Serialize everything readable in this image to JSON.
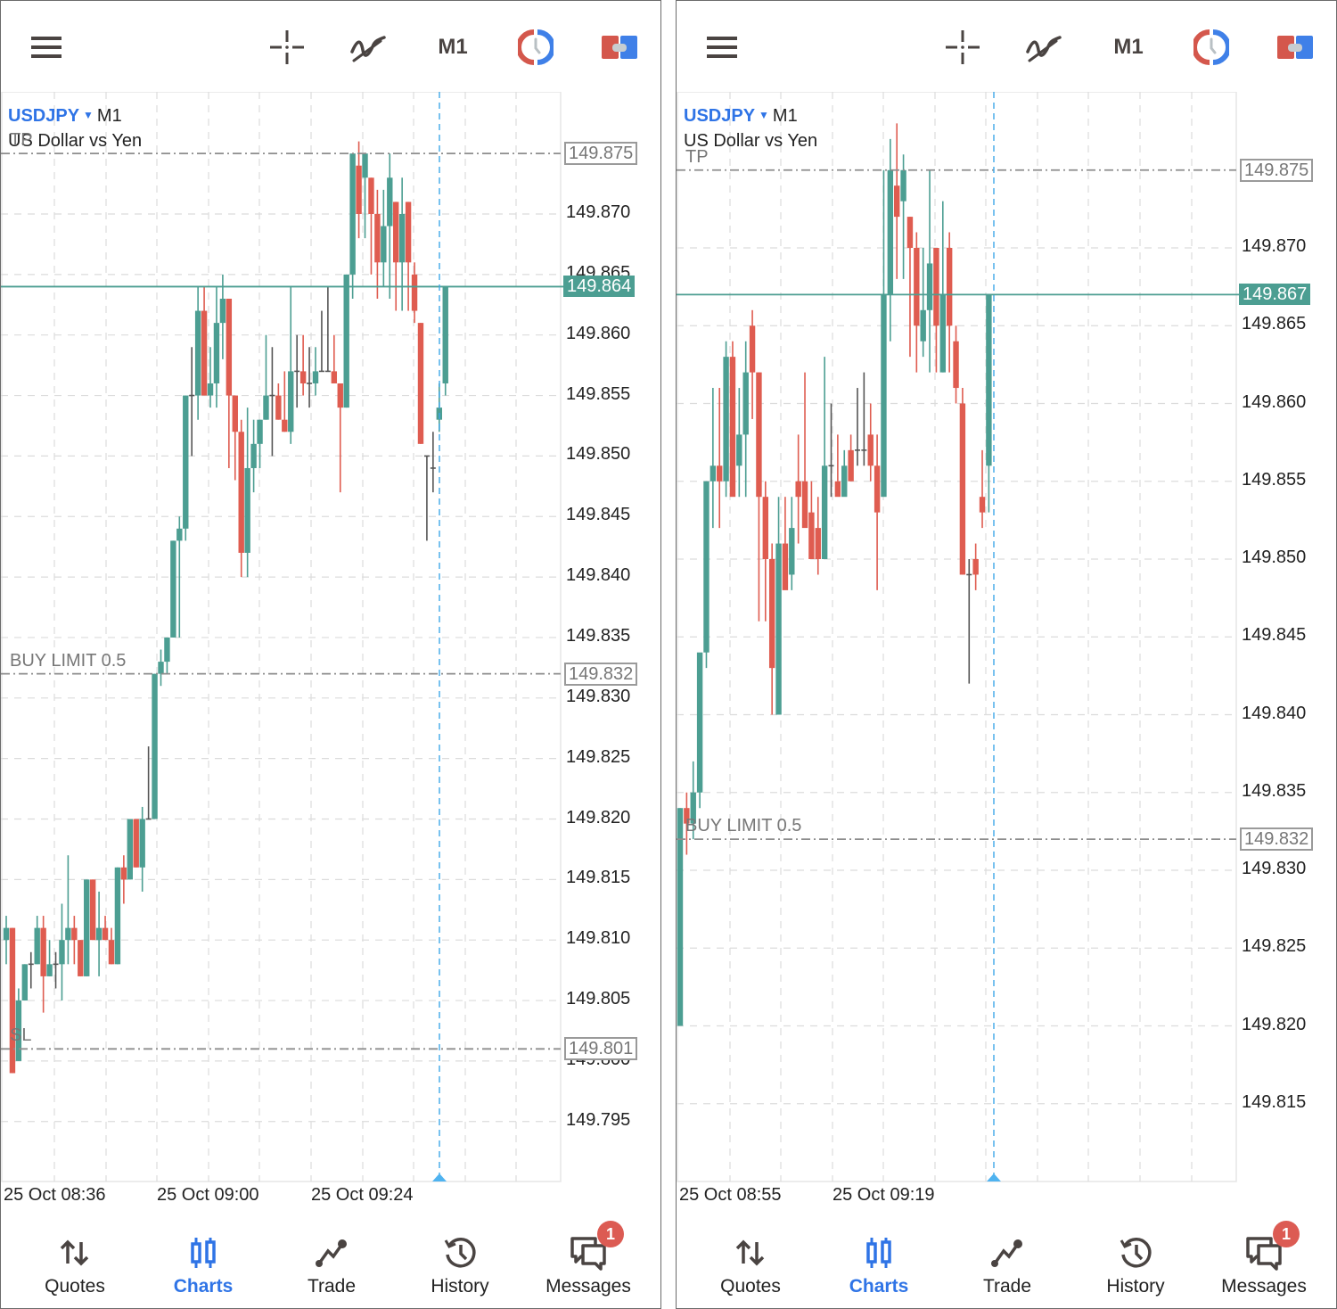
{
  "toolbar": {
    "menu_icon": "hamburger-menu-icon",
    "crosshair_icon": "crosshair-icon",
    "indicators_icon": "indicators-icon",
    "timeframe": "M1",
    "trade_clock_icon": "one-click-trading-icon",
    "toggle_icon": "trade-panel-toggle-icon",
    "colors": {
      "icon": "#4a4442",
      "red": "#d4574c",
      "blue": "#3f80e8"
    }
  },
  "bottom_nav": {
    "items": [
      {
        "label": "Quotes",
        "icon": "quotes-arrows-icon",
        "active": false
      },
      {
        "label": "Charts",
        "icon": "charts-candles-icon",
        "active": true
      },
      {
        "label": "Trade",
        "icon": "trade-line-icon",
        "active": false
      },
      {
        "label": "History",
        "icon": "history-clock-icon",
        "active": false
      },
      {
        "label": "Messages",
        "icon": "messages-icon",
        "active": false,
        "badge": "1"
      }
    ],
    "active_color": "#2f74e6"
  },
  "chart_data": [
    {
      "type": "candlestick",
      "symbol": "USDJPY",
      "timeframe": "M1",
      "description": "US Dollar vs Yen",
      "y_ticks": [
        "149.870",
        "149.865",
        "149.860",
        "149.855",
        "149.850",
        "149.845",
        "149.840",
        "149.835",
        "149.830",
        "149.825",
        "149.820",
        "149.815",
        "149.810",
        "149.805",
        "149.800",
        "149.795"
      ],
      "ylim": [
        149.7925,
        149.8755
      ],
      "x_ticks": [
        "25 Oct 08:36",
        "25 Oct 09:00",
        "25 Oct 09:24"
      ],
      "grid": true,
      "bull_color": "#4c9e92",
      "bear_color": "#df5c50",
      "doji_color": "#555555",
      "current_price": {
        "value": 149.864,
        "label": "149.864"
      },
      "levels": [
        {
          "name": "TP",
          "value": 149.875,
          "label": "149.875",
          "text": "TP"
        },
        {
          "name": "BUY LIMIT 0.5",
          "value": 149.832,
          "label": "149.832",
          "text": "BUY LIMIT 0.5"
        },
        {
          "name": "SL",
          "value": 149.801,
          "label": "149.801",
          "text": "SL"
        }
      ],
      "candles": [
        [
          149.81,
          149.812,
          149.808,
          149.811
        ],
        [
          149.811,
          149.811,
          149.799,
          149.799
        ],
        [
          149.8,
          149.806,
          149.8,
          149.805
        ],
        [
          149.805,
          149.808,
          149.805,
          149.808
        ],
        [
          149.808,
          149.809,
          149.806,
          149.808
        ],
        [
          149.808,
          149.812,
          149.808,
          149.811
        ],
        [
          149.811,
          149.812,
          149.804,
          149.807
        ],
        [
          149.807,
          149.81,
          149.807,
          149.808
        ],
        [
          149.808,
          149.809,
          149.806,
          149.808
        ],
        [
          149.808,
          149.813,
          149.805,
          149.81
        ],
        [
          149.81,
          149.817,
          149.808,
          149.811
        ],
        [
          149.811,
          149.812,
          149.808,
          149.81
        ],
        [
          149.81,
          149.81,
          149.807,
          149.807
        ],
        [
          149.807,
          149.815,
          149.807,
          149.815
        ],
        [
          149.815,
          149.815,
          149.81,
          149.81
        ],
        [
          149.81,
          149.814,
          149.807,
          149.811
        ],
        [
          149.811,
          149.812,
          149.81,
          149.81
        ],
        [
          149.81,
          149.811,
          149.808,
          149.808
        ],
        [
          149.808,
          149.816,
          149.808,
          149.816
        ],
        [
          149.816,
          149.817,
          149.813,
          149.815
        ],
        [
          149.815,
          149.82,
          149.815,
          149.82
        ],
        [
          149.82,
          149.82,
          149.816,
          149.816
        ],
        [
          149.816,
          149.821,
          149.814,
          149.82
        ],
        [
          149.82,
          149.826,
          149.82,
          149.82
        ],
        [
          149.82,
          149.832,
          149.82,
          149.832
        ],
        [
          149.832,
          149.834,
          149.831,
          149.833
        ],
        [
          149.833,
          149.835,
          149.832,
          149.835
        ],
        [
          149.835,
          149.843,
          149.835,
          149.843
        ],
        [
          149.843,
          149.845,
          149.835,
          149.844
        ],
        [
          149.844,
          149.855,
          149.843,
          149.855
        ],
        [
          149.855,
          149.859,
          149.85,
          149.855
        ],
        [
          149.855,
          149.864,
          149.853,
          149.862
        ],
        [
          149.862,
          149.864,
          149.855,
          149.855
        ],
        [
          149.855,
          149.859,
          149.854,
          149.856
        ],
        [
          149.856,
          149.864,
          149.854,
          149.861
        ],
        [
          149.861,
          149.865,
          149.858,
          149.863
        ],
        [
          149.863,
          149.863,
          149.849,
          149.855
        ],
        [
          149.855,
          149.855,
          149.848,
          149.852
        ],
        [
          149.852,
          149.853,
          149.84,
          149.842
        ],
        [
          149.842,
          149.854,
          149.84,
          149.849
        ],
        [
          149.849,
          149.853,
          149.847,
          149.851
        ],
        [
          149.851,
          149.853,
          149.849,
          149.853
        ],
        [
          149.853,
          149.86,
          149.853,
          149.855
        ],
        [
          149.855,
          149.859,
          149.85,
          149.855
        ],
        [
          149.855,
          149.856,
          149.853,
          149.853
        ],
        [
          149.853,
          149.857,
          149.852,
          149.852
        ],
        [
          149.852,
          149.864,
          149.851,
          149.857
        ],
        [
          149.857,
          149.86,
          149.854,
          149.857
        ],
        [
          149.857,
          149.86,
          149.855,
          149.856
        ],
        [
          149.856,
          149.859,
          149.854,
          149.856
        ],
        [
          149.856,
          149.859,
          149.855,
          149.857
        ],
        [
          149.857,
          149.862,
          149.857,
          149.857
        ],
        [
          149.857,
          149.864,
          149.857,
          149.857
        ],
        [
          149.857,
          149.86,
          149.856,
          149.856
        ],
        [
          149.856,
          149.856,
          149.847,
          149.854
        ],
        [
          149.854,
          149.865,
          149.854,
          149.865
        ],
        [
          149.865,
          149.874,
          149.863,
          149.875
        ],
        [
          149.874,
          149.876,
          149.868,
          149.87
        ],
        [
          149.873,
          149.874,
          149.868,
          149.875
        ],
        [
          149.873,
          149.873,
          149.865,
          149.87
        ],
        [
          149.87,
          149.872,
          149.863,
          149.866
        ],
        [
          149.866,
          149.872,
          149.864,
          149.869
        ],
        [
          149.869,
          149.875,
          149.863,
          149.873
        ],
        [
          149.871,
          149.871,
          149.862,
          149.866
        ],
        [
          149.866,
          149.873,
          149.862,
          149.87
        ],
        [
          149.871,
          149.871,
          149.862,
          149.866
        ],
        [
          149.865,
          149.866,
          149.861,
          149.862
        ],
        [
          149.861,
          149.861,
          149.851,
          149.851
        ],
        [
          149.85,
          149.85,
          149.843,
          149.85
        ],
        [
          149.849,
          149.852,
          149.847,
          149.849
        ],
        [
          149.853,
          149.856,
          149.852,
          149.854
        ],
        [
          149.856,
          149.864,
          149.855,
          149.864
        ]
      ]
    },
    {
      "type": "candlestick",
      "symbol": "USDJPY",
      "timeframe": "M1",
      "description": "US Dollar vs Yen",
      "y_ticks": [
        "149.870",
        "149.865",
        "149.860",
        "149.855",
        "149.850",
        "149.845",
        "149.840",
        "149.835",
        "149.830",
        "149.825",
        "149.820",
        "149.815"
      ],
      "ylim": [
        149.8117,
        149.8767
      ],
      "x_ticks": [
        "25 Oct 08:55",
        "25 Oct 09:19"
      ],
      "grid": true,
      "bull_color": "#4c9e92",
      "bear_color": "#df5c50",
      "doji_color": "#555555",
      "current_price": {
        "value": 149.867,
        "label": "149.867"
      },
      "levels": [
        {
          "name": "TP",
          "value": 149.875,
          "label": "149.875",
          "text": "TP"
        },
        {
          "name": "BUY LIMIT 0.5",
          "value": 149.832,
          "label": "149.832",
          "text": "BUY LIMIT 0.5"
        }
      ],
      "candles": [
        [
          149.82,
          149.834,
          149.82,
          149.834
        ],
        [
          149.834,
          149.835,
          149.831,
          149.833
        ],
        [
          149.833,
          149.837,
          149.832,
          149.835
        ],
        [
          149.835,
          149.843,
          149.834,
          149.844
        ],
        [
          149.844,
          149.855,
          149.843,
          149.855
        ],
        [
          149.855,
          149.861,
          149.852,
          149.856
        ],
        [
          149.856,
          149.861,
          149.852,
          149.855
        ],
        [
          149.855,
          149.864,
          149.854,
          149.863
        ],
        [
          149.863,
          149.864,
          149.855,
          149.854
        ],
        [
          149.856,
          149.861,
          149.854,
          149.858
        ],
        [
          149.858,
          149.864,
          149.854,
          149.862
        ],
        [
          149.865,
          149.866,
          149.859,
          149.862
        ],
        [
          149.862,
          149.862,
          149.846,
          149.854
        ],
        [
          149.854,
          149.855,
          149.846,
          149.85
        ],
        [
          149.85,
          149.851,
          149.84,
          149.843
        ],
        [
          149.84,
          149.854,
          149.84,
          149.851
        ],
        [
          149.851,
          149.854,
          149.849,
          149.848
        ],
        [
          149.849,
          149.854,
          149.848,
          149.852
        ],
        [
          149.855,
          149.858,
          149.851,
          149.854
        ],
        [
          149.855,
          149.862,
          149.853,
          149.852
        ],
        [
          149.853,
          149.855,
          149.851,
          149.85
        ],
        [
          149.852,
          149.854,
          149.849,
          149.85
        ],
        [
          149.85,
          149.863,
          149.85,
          149.856
        ],
        [
          149.856,
          149.86,
          149.854,
          149.856
        ],
        [
          149.855,
          149.858,
          149.855,
          149.854
        ],
        [
          149.854,
          149.857,
          149.855,
          149.856
        ],
        [
          149.857,
          149.858,
          149.855,
          149.855
        ],
        [
          149.857,
          149.861,
          149.856,
          149.857
        ],
        [
          149.857,
          149.862,
          149.856,
          149.857
        ],
        [
          149.858,
          149.86,
          149.855,
          149.856
        ],
        [
          149.856,
          149.858,
          149.848,
          149.853
        ],
        [
          149.854,
          149.875,
          149.855,
          149.867
        ],
        [
          149.867,
          149.877,
          149.864,
          149.875
        ],
        [
          149.874,
          149.878,
          149.868,
          149.872
        ],
        [
          149.873,
          149.876,
          149.868,
          149.875
        ],
        [
          149.872,
          149.872,
          149.863,
          149.87
        ],
        [
          149.87,
          149.871,
          149.862,
          149.865
        ],
        [
          149.864,
          149.87,
          149.863,
          149.866
        ],
        [
          149.866,
          149.875,
          149.862,
          149.869
        ],
        [
          149.87,
          149.87,
          149.862,
          149.865
        ],
        [
          149.862,
          149.873,
          149.862,
          149.867
        ],
        [
          149.87,
          149.871,
          149.862,
          149.865
        ],
        [
          149.864,
          149.865,
          149.86,
          149.861
        ],
        [
          149.86,
          149.861,
          149.849,
          149.849
        ],
        [
          149.849,
          149.85,
          149.842,
          149.849
        ],
        [
          149.85,
          149.851,
          149.848,
          149.849
        ],
        [
          149.854,
          149.857,
          149.852,
          149.853
        ],
        [
          149.856,
          149.867,
          149.853,
          149.867
        ]
      ]
    }
  ]
}
